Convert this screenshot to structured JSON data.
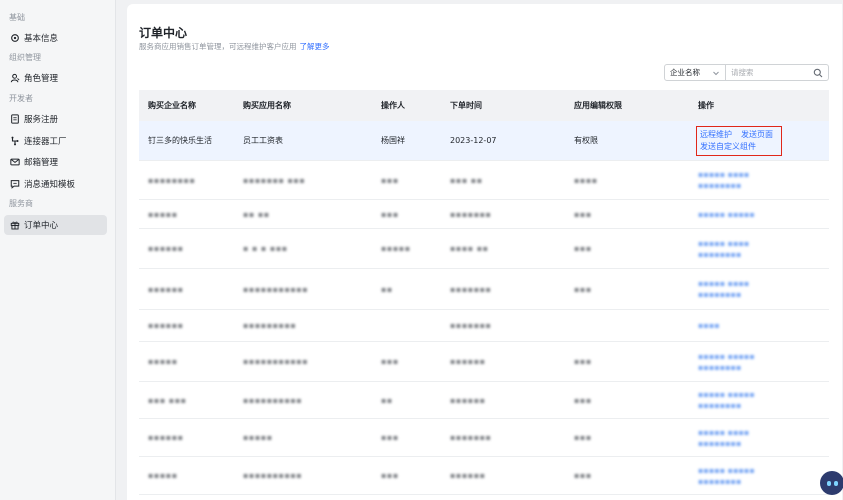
{
  "sidebar": {
    "groups": [
      {
        "label": "基础",
        "items": [
          {
            "label": "基本信息",
            "icon": "gear-icon"
          }
        ]
      },
      {
        "label": "组织管理",
        "items": [
          {
            "label": "角色管理",
            "icon": "user-icon"
          }
        ]
      },
      {
        "label": "开发者",
        "items": [
          {
            "label": "服务注册",
            "icon": "document-icon"
          },
          {
            "label": "连接器工厂",
            "icon": "connector-icon"
          },
          {
            "label": "邮箱管理",
            "icon": "mail-icon"
          },
          {
            "label": "消息通知模板",
            "icon": "message-icon"
          }
        ]
      },
      {
        "label": "服务商",
        "items": [
          {
            "label": "订单中心",
            "icon": "gift-icon",
            "active": true
          }
        ]
      }
    ]
  },
  "page": {
    "title": "订单中心",
    "description": "服务商应用销售订单管理，可远程维护客户应用",
    "learn_more": "了解更多"
  },
  "filter": {
    "select_value": "企业名称",
    "search_placeholder": "请搜索"
  },
  "table": {
    "columns": [
      "购买企业名称",
      "购买应用名称",
      "操作人",
      "下单时间",
      "应用编辑权限",
      "操作"
    ],
    "first_row": {
      "company": "钉三多的快乐生活",
      "app": "员工工资表",
      "operator": "杨国祥",
      "date": "2023-12-07",
      "permission": "有权限",
      "actions": [
        "远程维护",
        "发送页面",
        "发送自定义组件"
      ]
    },
    "blurred_rows": [
      {
        "c1": "▪▪▪▪▪▪▪▪",
        "c2": "▪▪▪▪▪▪▪ ▪▪▪",
        "c3": "▪▪▪",
        "c4": "▪▪▪ ▪▪",
        "c5": "▪▪▪▪",
        "l1": "▪▪▪▪▪ ▪▪▪▪",
        "l2": "▪▪▪▪▪▪▪▪"
      },
      {
        "c1": "▪▪▪▪▪",
        "c2": "▪▪ ▪▪",
        "c3": "▪▪▪",
        "c4": "▪▪▪▪▪▪▪",
        "c5": "▪▪▪",
        "l1": "▪▪▪▪▪ ▪▪▪▪▪",
        "l2": ""
      },
      {
        "c1": "▪▪▪▪▪▪",
        "c2": "▪ ▪ ▪ ▪▪▪",
        "c3": "▪▪▪▪▪",
        "c4": "▪▪▪▪ ▪▪",
        "c5": "▪▪▪",
        "l1": "▪▪▪▪▪ ▪▪▪▪",
        "l2": "▪▪▪▪▪▪▪▪"
      },
      {
        "c1": "▪▪▪▪▪▪",
        "c2": "▪▪▪▪▪▪▪▪▪▪▪",
        "c3": "▪▪",
        "c4": "▪▪▪▪▪▪▪",
        "c5": "▪▪▪",
        "l1": "▪▪▪▪▪ ▪▪▪▪",
        "l2": "▪▪▪▪▪▪▪▪"
      },
      {
        "c1": "▪▪▪▪▪▪",
        "c2": "▪▪▪▪▪▪▪▪▪",
        "c3": "",
        "c4": "▪▪▪▪▪▪▪",
        "c5": "",
        "l1": "▪▪▪▪",
        "l2": ""
      },
      {
        "c1": "▪▪▪▪▪",
        "c2": "▪▪▪▪▪▪▪▪▪▪▪",
        "c3": "▪▪▪",
        "c4": "▪▪▪▪▪▪",
        "c5": "▪▪▪",
        "l1": "▪▪▪▪▪ ▪▪▪▪▪",
        "l2": "▪▪▪▪▪▪▪▪"
      },
      {
        "c1": "▪▪▪ ▪▪▪",
        "c2": "▪▪▪▪▪▪▪▪▪▪",
        "c3": "▪▪",
        "c4": "▪▪▪▪▪▪",
        "c5": "▪▪▪",
        "l1": "▪▪▪▪▪ ▪▪▪▪▪",
        "l2": "▪▪▪▪▪▪▪▪"
      },
      {
        "c1": "▪▪▪▪▪▪",
        "c2": "▪▪▪▪▪",
        "c3": "▪▪▪",
        "c4": "▪▪▪▪▪▪▪",
        "c5": "▪▪▪",
        "l1": "▪▪▪▪▪ ▪▪▪▪",
        "l2": "▪▪▪▪▪▪▪▪"
      },
      {
        "c1": "▪▪▪▪▪",
        "c2": "▪▪▪▪▪▪▪▪▪▪",
        "c3": "▪▪▪",
        "c4": "▪▪▪▪▪▪",
        "c5": "▪▪▪",
        "l1": "▪▪▪▪▪ ▪▪▪▪▪",
        "l2": "▪▪▪▪▪▪▪▪"
      }
    ]
  },
  "colors": {
    "accent": "#3370ff",
    "highlight_border": "#e0271a",
    "highlight_row": "#eef4ff"
  }
}
